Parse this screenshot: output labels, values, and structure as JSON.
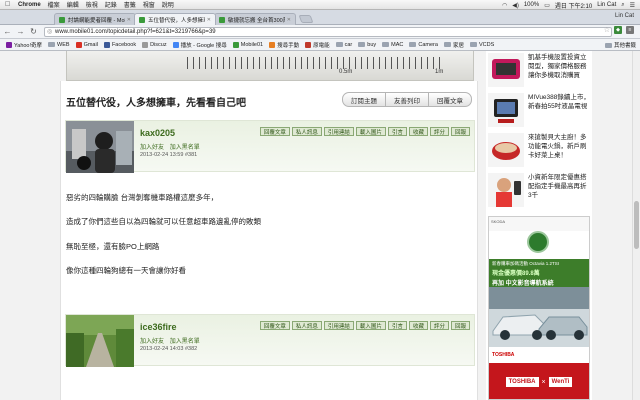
{
  "menubar": {
    "app": "Chrome",
    "items": [
      "檔案",
      "編輯",
      "檢視",
      "記錄",
      "書籤",
      "視窗",
      "說明"
    ],
    "battery": "100%",
    "clock": "週日 下午2:10",
    "user": "Lin Cat"
  },
  "tabs": [
    {
      "label": "討論網能愛者回覆 - Mobile01 ...",
      "active": false
    },
    {
      "label": "五位替代役，人多想擁車，先...",
      "active": true
    },
    {
      "label": "敏捷就忘搬 全台首300萬...",
      "active": false
    }
  ],
  "browser": {
    "url": "www.mobile01.com/topicdetail.php?f=621&t=3219766&p=39",
    "user_label": "Lin Cat"
  },
  "bookmarks": [
    "Yahoo!奇摩",
    "WEB",
    "Gmail",
    "Facebook",
    "Discuz",
    "播放 - Google 搜尋",
    "Mobile01",
    "搜尋手動",
    "原電能",
    "car",
    "buy",
    "MAC",
    "Camera",
    "家居",
    "VCDS"
  ],
  "bookmarks_other": "其他書籤",
  "ruler": {
    "labels": [
      "0.5m",
      "1m"
    ]
  },
  "thread": {
    "title": "五位替代役，人多想擁車，先看看自己吧",
    "buttons": [
      "訂閱主題",
      "友善列印",
      "回覆文章"
    ]
  },
  "post_buttons": [
    "回覆文章",
    "私人訊息",
    "引用連結",
    "載入圖片",
    "引言",
    "收藏",
    "評分",
    "回報"
  ],
  "posts": [
    {
      "username": "kax0205",
      "links": [
        "加入好友",
        "加入黑名單"
      ],
      "meta": "2013-02-24 13:59  #381",
      "lines": [
        "惡劣的四輪購臉 台灣剝奪機車路權這麼多年，",
        "造成了你們這些自以為四輪就可以任意超車路邊亂停的敗類",
        "無恥至極，還有臉PO上網路",
        "像你這種四輪狗總有一天會讓你好看"
      ]
    },
    {
      "username": "ice36fire",
      "links": [
        "加入好友",
        "加入黑名單"
      ],
      "meta": "2013-02-24 14:03  #382",
      "lines": []
    }
  ],
  "sidebar": {
    "ads": [
      {
        "text": "凱基手機設置投資立閱型，獨家價格服務讓你多機取消購買"
      },
      {
        "text": "MIVue388錄續上市，新春拍55吋液晶電視"
      },
      {
        "text": "來搶製貝大主廚！多功能電火鍋，新戶刷卡好菜上桌！"
      },
      {
        "text": "小資新年限定優惠搭配指定手機最高再折3千"
      }
    ],
    "banner": {
      "top": "SKODA",
      "line1": "新春購車加碼活動 Octavia 1.2TSI",
      "line2": "現金優惠價89.8萬",
      "line3": "再加 中文影音導航系統",
      "brand1": "TOSHIBA",
      "x": "×",
      "brand2": "WenTi"
    }
  }
}
